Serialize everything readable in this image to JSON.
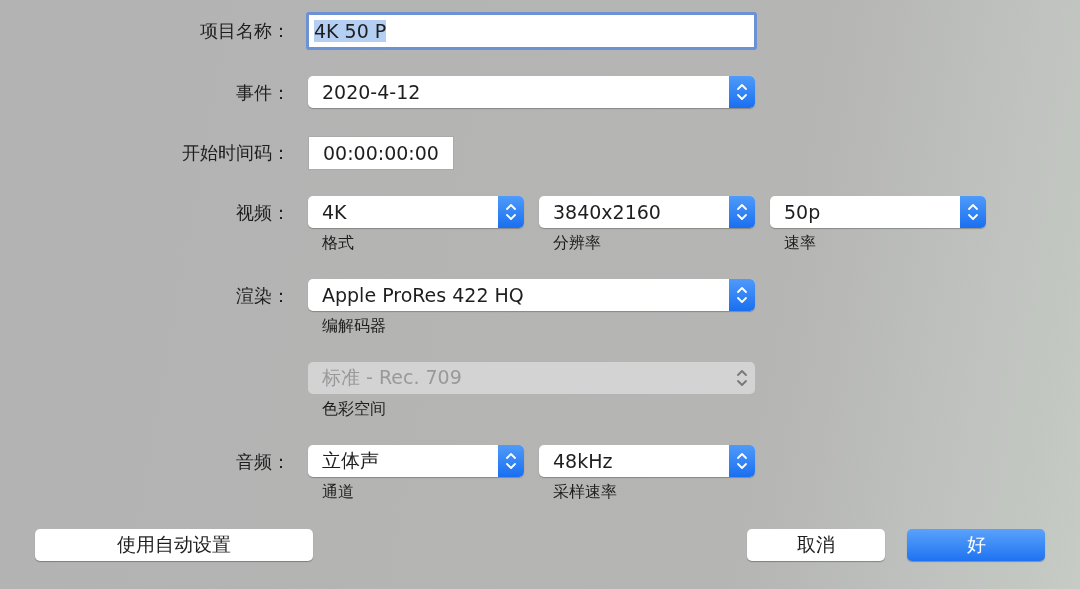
{
  "rows": [
    {
      "kind": "text",
      "label": "项目名称：",
      "value": "4K 50 P",
      "focused": true
    },
    {
      "kind": "popups",
      "label": "事件：",
      "popups": [
        {
          "value": "2020-4-12",
          "disabled": false
        }
      ]
    },
    {
      "kind": "timecode",
      "label": "开始时间码：",
      "value": "00:00:00:00"
    },
    {
      "kind": "popups",
      "label": "视频：",
      "popups": [
        {
          "value": "4K",
          "caption": "格式",
          "disabled": false
        },
        {
          "value": "3840x2160",
          "caption": "分辨率",
          "disabled": false
        },
        {
          "value": "50p",
          "caption": "速率",
          "disabled": false
        }
      ]
    },
    {
      "kind": "popups",
      "label": "渲染：",
      "popups": [
        {
          "value": "Apple ProRes 422 HQ",
          "caption": "编解码器",
          "disabled": false
        }
      ]
    },
    {
      "kind": "popups",
      "popups": [
        {
          "value": "标准 - Rec. 709",
          "caption": "色彩空间",
          "disabled": true
        }
      ]
    },
    {
      "kind": "popups",
      "label": "音频：",
      "popups": [
        {
          "value": "立体声",
          "caption": "通道",
          "disabled": false
        },
        {
          "value": "48kHz",
          "caption": "采样速率",
          "disabled": false
        }
      ]
    }
  ],
  "buttons_left": [
    {
      "label": "使用自动设置",
      "default": false
    }
  ],
  "buttons_right": [
    {
      "label": "取消",
      "default": false
    },
    {
      "label": "好",
      "default": true
    }
  ]
}
